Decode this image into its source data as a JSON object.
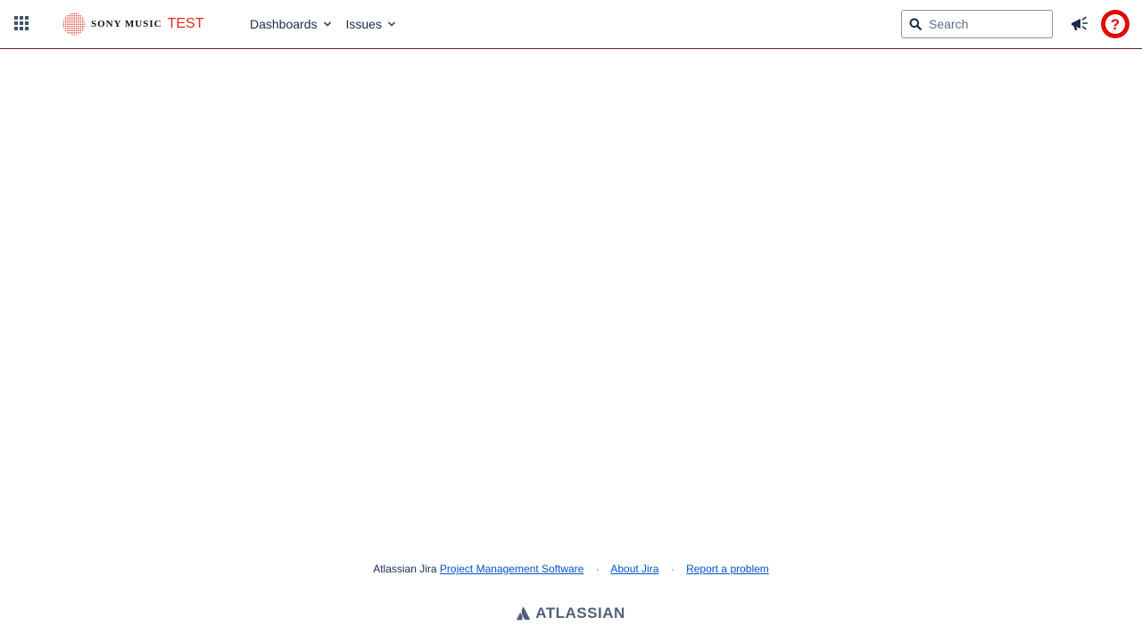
{
  "header": {
    "app_switcher_icon": "grid-icon",
    "logo": {
      "brand_text": "SONY MUSIC",
      "env_text": "TEST",
      "mark_icon": "sony-music-dots-logo",
      "brand_color": "#e0281f"
    },
    "nav": [
      {
        "label": "Dashboards",
        "icon": "chevron-down-icon"
      },
      {
        "label": "Issues",
        "icon": "chevron-down-icon"
      }
    ],
    "search": {
      "placeholder": "Search",
      "value": "",
      "icon": "search-icon"
    },
    "announcement_icon": "megaphone-icon",
    "help_icon": "help-icon",
    "help_color": "#de0a0a",
    "border_color": "#6b1d22"
  },
  "footer": {
    "prefix": "Atlassian Jira",
    "links": {
      "pms": "Project Management Software",
      "about": "About Jira",
      "report": "Report a problem"
    },
    "separator": "·",
    "atlassian_wordmark": "ATLASSIAN",
    "atlassian_icon": "atlassian-logo-icon"
  }
}
